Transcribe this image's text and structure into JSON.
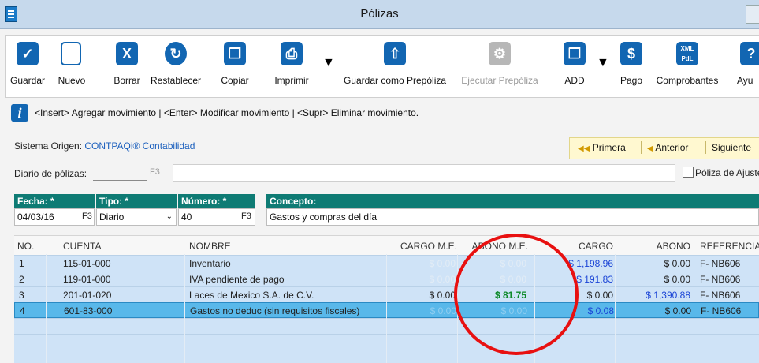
{
  "window": {
    "title": "Pólizas"
  },
  "toolbar": {
    "guardar": "Guardar",
    "nuevo": "Nuevo",
    "borrar": "Borrar",
    "restablecer": "Restablecer",
    "copiar": "Copiar",
    "imprimir": "Imprimir",
    "guardar_prepoliza": "Guardar como Prepóliza",
    "ejecutar_prepoliza": "Ejecutar Prepóliza",
    "add": "ADD",
    "pago": "Pago",
    "comprobantes": "Comprobantes",
    "ayuda": "Ayu",
    "xml_icon_text": "XML PdL"
  },
  "info": {
    "text": "<Insert> Agregar movimiento | <Enter> Modificar movimiento | <Supr> Eliminar movimiento."
  },
  "origin": {
    "label": "Sistema Origen:",
    "value": "CONTPAQi® Contabilidad"
  },
  "nav": {
    "primera": "Primera",
    "anterior": "Anterior",
    "siguiente": "Siguiente"
  },
  "diario": {
    "label": "Diario de pólizas:",
    "f3": "F3",
    "ajuste_label": "Póliza de Ajuste"
  },
  "form": {
    "fecha_label": "Fecha: *",
    "fecha_value": "04/03/16",
    "tipo_label": "Tipo: *",
    "tipo_value": "Diario",
    "numero_label": "Número: *",
    "numero_value": "40",
    "concepto_label": "Concepto:",
    "concepto_value": "Gastos y compras del día",
    "f3": "F3"
  },
  "table": {
    "columns": [
      "NO.",
      "CUENTA",
      "NOMBRE",
      "CARGO M.E.",
      "ABONO M.E.",
      "CARGO",
      "ABONO",
      "REFERENCIA"
    ],
    "rows": [
      {
        "no": "1",
        "cuenta": "115-01-000",
        "nombre": "Inventario",
        "cargo_me": "$ 0.00",
        "abono_me": "$ 0.00",
        "cargo": "$ 1,198.96",
        "abono": "$ 0.00",
        "ref": "F- NB606"
      },
      {
        "no": "2",
        "cuenta": "119-01-000",
        "nombre": "IVA pendiente de pago",
        "cargo_me": "$ 0.00",
        "abono_me": "$ 0.00",
        "cargo": "$ 191.83",
        "abono": "$ 0.00",
        "ref": "F- NB606"
      },
      {
        "no": "3",
        "cuenta": "201-01-020",
        "nombre": "Laces de Mexico S.A. de C.V.",
        "cargo_me": "$ 0.00",
        "abono_me": "$ 81.75",
        "cargo": "$ 0.00",
        "abono": "$ 1,390.88",
        "ref": "F- NB606"
      },
      {
        "no": "4",
        "cuenta": "601-83-000",
        "nombre": "Gastos no deduc (sin requisitos fiscales)",
        "cargo_me": "$ 0.00",
        "abono_me": "$ 0.00",
        "cargo": "$ 0.08",
        "abono": "$ 0.00",
        "ref": "F- NB606"
      }
    ]
  },
  "colors": {
    "accent": "#1266b2",
    "header_teal": "#0e7b74",
    "row_bg": "#cfe3f7",
    "selected_row": "#59b8ea",
    "annotation_red": "#e81010"
  }
}
